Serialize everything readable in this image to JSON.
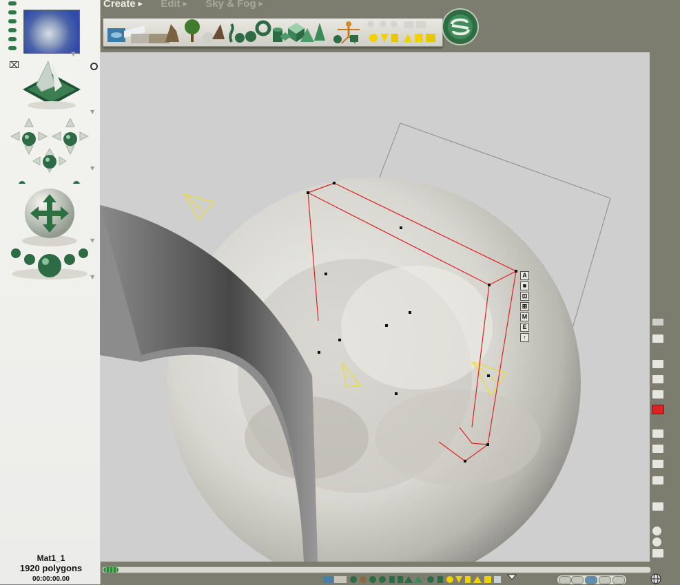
{
  "menu": {
    "items": [
      {
        "label": "Create",
        "active": true
      },
      {
        "label": "Edit",
        "active": false
      },
      {
        "label": "Sky & Fog",
        "active": false
      }
    ]
  },
  "toolbar": {
    "create_tools": [
      "water-icon",
      "plane-icon",
      "ground-icon",
      "rock-icon",
      "tree-icon",
      "stone-icon",
      "plant-icon",
      "sphere-icon",
      "torus-icon",
      "cylinder-icon",
      "cube-icon",
      "cone-icon",
      "pyramid-icon",
      "figure-icon",
      "primitives-icon"
    ],
    "logo": "bryce-logo-icon"
  },
  "left_controls": [
    "scene-thumbnail",
    "camera-cross-controls",
    "trackball-control",
    "camera-position-dots"
  ],
  "selection_tools": [
    "A",
    "■",
    "⊡",
    "⊞",
    "M",
    "E",
    "↑"
  ],
  "right_tools": [
    "brush-icon",
    "eraser-icon",
    "view-icon",
    "wireframe-icon",
    "texture-icon",
    "render-icon",
    "layers-icon",
    "fill-icon",
    "shade-icon",
    "display-icon",
    "cube-view-icon",
    "zoom-in-icon",
    "zoom-out-icon",
    "hand-icon"
  ],
  "status": {
    "object_name": "Mat1_1",
    "polygons": "1920 polygons",
    "time": "00:00:00.00"
  },
  "colors": {
    "background": "#7c7d6e",
    "panel": "#f0f0ec",
    "viewport": "#cfcfcf",
    "selection": "#e02020",
    "camera": "#f2e000",
    "accent": "#2a6b45"
  }
}
